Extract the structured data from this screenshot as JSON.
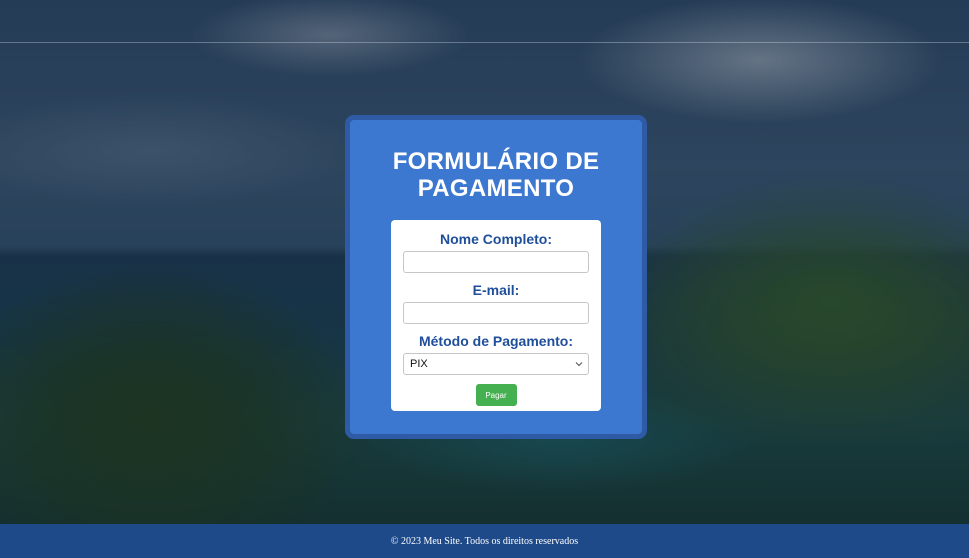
{
  "form": {
    "title_line1": "FORMULÁRIO DE",
    "title_line2": "PAGAMENTO",
    "fields": {
      "name_label": "Nome Completo:",
      "name_value": "",
      "email_label": "E-mail:",
      "email_value": "",
      "payment_label": "Método de Pagamento:",
      "payment_selected": "PIX"
    },
    "submit_label": "Pagar"
  },
  "footer": {
    "text": "© 2023 Meu Site. Todos os direitos reservados"
  },
  "colors": {
    "card_background": "#3c78cf",
    "card_border": "#2f5ba6",
    "label_text": "#1f4f9b",
    "button": "#45b04f",
    "footer": "#1e4a8a"
  },
  "icons": {
    "select_arrow": "chevron-down-icon"
  }
}
